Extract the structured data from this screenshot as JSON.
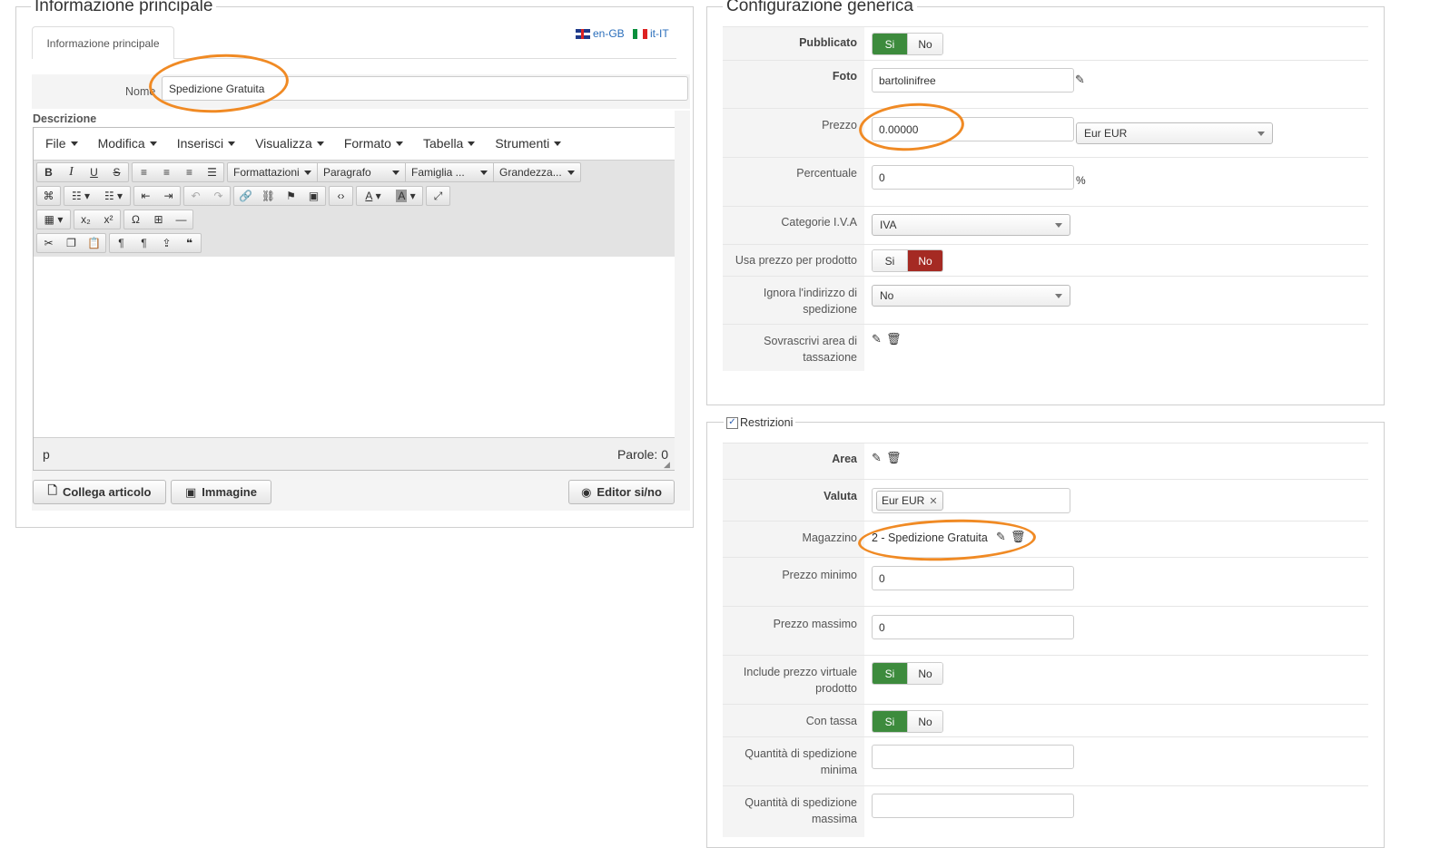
{
  "left": {
    "legend": "Informazione principale",
    "tab": "Informazione principale",
    "langs": [
      "en-GB",
      "it-IT"
    ],
    "name_label": "Nome",
    "name_value": "Spedizione Gratuita",
    "desc_label": "Descrizione",
    "menu": [
      "File",
      "Modifica",
      "Inserisci",
      "Visualizza",
      "Formato",
      "Tabella",
      "Strumenti"
    ],
    "toolbar": {
      "formattazioni": "Formattazioni",
      "paragrafo": "Paragrafo",
      "famiglia": "Famiglia ...",
      "grandezza": "Grandezza..."
    },
    "status_path": "p",
    "word_count": "Parole: 0",
    "buttons": {
      "collega": "Collega articolo",
      "immagine": "Immagine",
      "editor": "Editor si/no"
    }
  },
  "config": {
    "legend": "Configurazione generica",
    "pubblicato_label": "Pubblicato",
    "yes": "Si",
    "no": "No",
    "foto_label": "Foto",
    "foto_value": "bartolinifree",
    "prezzo_label": "Prezzo",
    "prezzo_value": "0.00000",
    "currency_value": "Eur EUR",
    "percentuale_label": "Percentuale",
    "percentuale_value": "0",
    "percent_sign": "%",
    "iva_label": "Categorie I.V.A",
    "iva_value": "IVA",
    "usa_prezzo_label": "Usa prezzo per prodotto",
    "ignora_label": "Ignora l'indirizzo di spedizione",
    "ignora_value": "No",
    "sovrascrivi_label": "Sovrascrivi area di tassazione"
  },
  "restr": {
    "legend": "Restrizioni",
    "area_label": "Area",
    "valuta_label": "Valuta",
    "valuta_tag": "Eur EUR",
    "magazzino_label": "Magazzino",
    "magazzino_value": "2 - Spedizione Gratuita",
    "prezzo_min_label": "Prezzo minimo",
    "prezzo_min_value": "0",
    "prezzo_max_label": "Prezzo massimo",
    "prezzo_max_value": "0",
    "include_label": "Include prezzo virtuale prodotto",
    "con_tassa_label": "Con tassa",
    "qmin_label": "Quantità di spedizione minima",
    "qmax_label": "Quantità di spedizione massima"
  },
  "colors": {
    "orange_annotation": "#f08a24",
    "green_on": "#3d8b3d",
    "red_on": "#a52a23"
  }
}
